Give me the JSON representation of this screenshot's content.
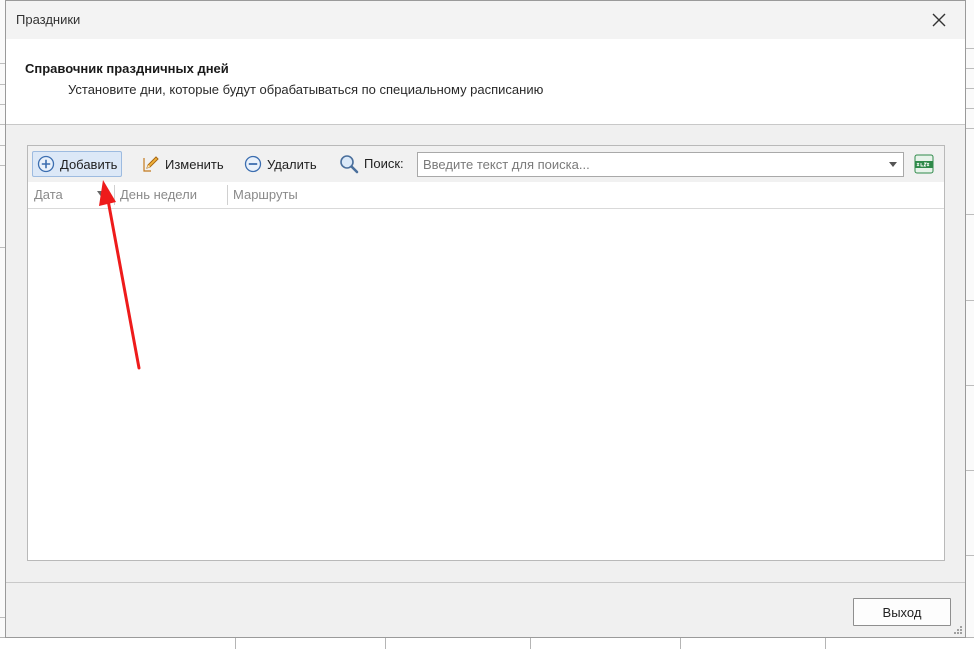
{
  "window": {
    "title": "Праздники",
    "close_icon": "close-icon"
  },
  "header": {
    "title": "Справочник праздничных дней",
    "subtitle": "Установите дни, которые будут обрабатываться по специальному расписанию"
  },
  "toolbar": {
    "add_label": "Добавить",
    "add_icon": "plus-circle-icon",
    "edit_label": "Изменить",
    "edit_icon": "pencil-icon",
    "delete_label": "Удалить",
    "delete_icon": "minus-circle-icon",
    "search_label": "Поиск:",
    "search_icon": "magnifier-icon",
    "search_placeholder": "Введите текст для поиска...",
    "export_icon": "xlsx-export-icon"
  },
  "grid": {
    "columns": [
      {
        "label": "Дата",
        "sorted": "desc"
      },
      {
        "label": "День недели"
      },
      {
        "label": "Маршруты"
      }
    ],
    "rows": []
  },
  "footer": {
    "exit_label": "Выход"
  },
  "colors": {
    "dialog_bg": "#f0f0f0",
    "accent_active": "#dce8f7",
    "annotation_arrow": "#ee1b1b"
  }
}
